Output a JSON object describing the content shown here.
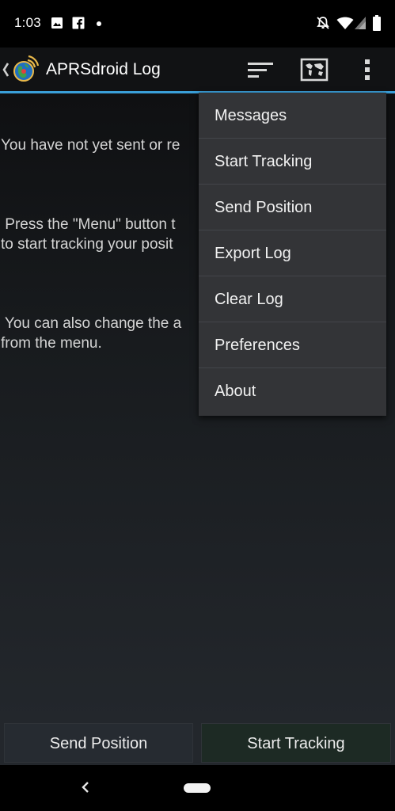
{
  "status_bar": {
    "time": "1:03",
    "icons": [
      "image-icon",
      "facebook-icon",
      "dot-icon",
      "dnd-off-icon",
      "wifi-icon",
      "signal-icon",
      "battery-icon"
    ]
  },
  "action_bar": {
    "title": "APRSdroid Log",
    "accent_color": "#3a9fd9",
    "icons": [
      "back-icon",
      "app-logo-icon",
      "sort-icon",
      "map-icon",
      "more-vert-icon"
    ]
  },
  "log": {
    "paragraphs": [
      "You have not yet sent or re",
      " Press the \"Menu\" button t\nto start tracking your posit",
      " You can also change the a\nfrom the menu."
    ]
  },
  "menu": {
    "items": [
      "Messages",
      "Start Tracking",
      "Send Position",
      "Export Log",
      "Clear Log",
      "Preferences",
      "About"
    ]
  },
  "bottom_buttons": {
    "send_position": "Send Position",
    "start_tracking": "Start Tracking"
  },
  "nav_bar": {
    "icons": [
      "nav-back-icon",
      "home-pill-icon"
    ]
  }
}
